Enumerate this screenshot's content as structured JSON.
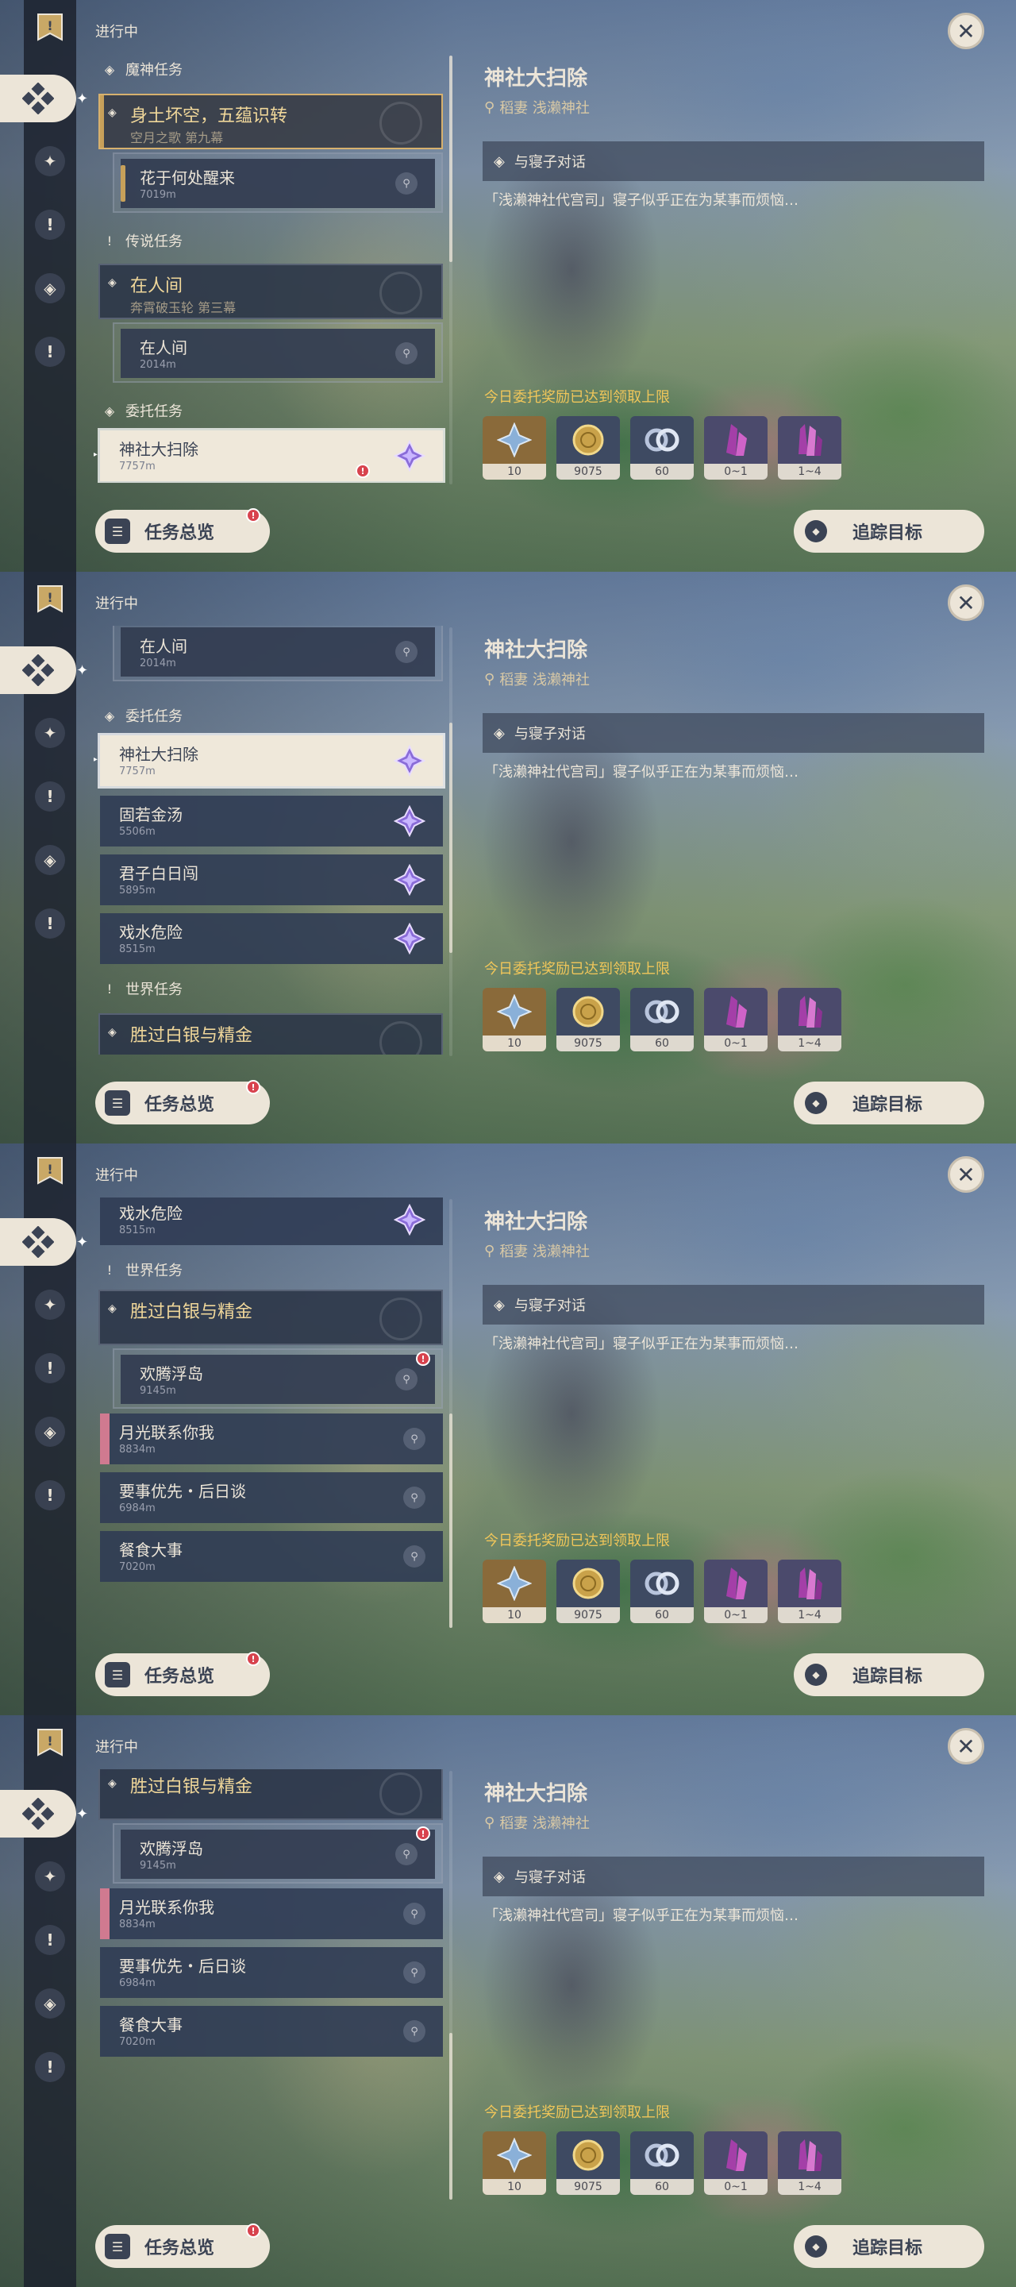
{
  "header": {
    "in_progress": "进行中"
  },
  "categories": {
    "archon": "魔神任务",
    "story": "传说任务",
    "commission": "委托任务",
    "world": "世界任务"
  },
  "quests": {
    "archon_parent": {
      "title": "身土坏空，五蕴识转",
      "sub": "空月之歌 第九幕"
    },
    "archon_child": {
      "title": "花于何处醒来",
      "dist": "7019m"
    },
    "story_parent": {
      "title": "在人间",
      "sub": "奔霄破玉轮 第三幕"
    },
    "story_child": {
      "title": "在人间",
      "dist": "2014m"
    },
    "shrine": {
      "title": "神社大扫除",
      "dist": "7757m"
    },
    "golden_soup": {
      "title": "固若金汤",
      "dist": "5506m"
    },
    "junzi": {
      "title": "君子白日闯",
      "dist": "5895m"
    },
    "water": {
      "title": "戏水危险",
      "dist": "8515m"
    },
    "world_parent": {
      "title": "胜过白银与精金"
    },
    "floating_isle": {
      "title": "欢腾浮岛",
      "dist": "9145m"
    },
    "moonlight": {
      "title": "月光联系你我",
      "dist": "8834m"
    },
    "priority": {
      "title": "要事优先・后日谈",
      "dist": "6984m"
    },
    "feast": {
      "title": "餐食大事",
      "dist": "7020m"
    }
  },
  "detail": {
    "title": "神社大扫除",
    "location": "稻妻 浅濑神社",
    "objective": "与寝子对话",
    "description": "「浅濑神社代宫司」寝子似乎正在为某事而烦恼…",
    "reward_label": "今日委托奖励已达到领取上限",
    "rewards": [
      {
        "icon": "adventure-exp-icon",
        "count": "10",
        "bg": "#8a6a3a"
      },
      {
        "icon": "mora-coin-icon",
        "count": "9075",
        "bg": "#3e4a62"
      },
      {
        "icon": "friendship-exp-icon",
        "count": "60",
        "bg": "#3e4a62"
      },
      {
        "icon": "crystal-ore-icon",
        "count": "0~1",
        "bg": "#4b4a6c"
      },
      {
        "icon": "crystal-cluster-icon",
        "count": "1~4",
        "bg": "#4b4a6c"
      }
    ]
  },
  "buttons": {
    "overview": "任务总览",
    "track": "追踪目标"
  },
  "colors": {
    "accent_gold": "#c7a05a",
    "cream": "#ece5d8",
    "alert": "#d8434e",
    "commission_purple": "#8a6cd8"
  }
}
